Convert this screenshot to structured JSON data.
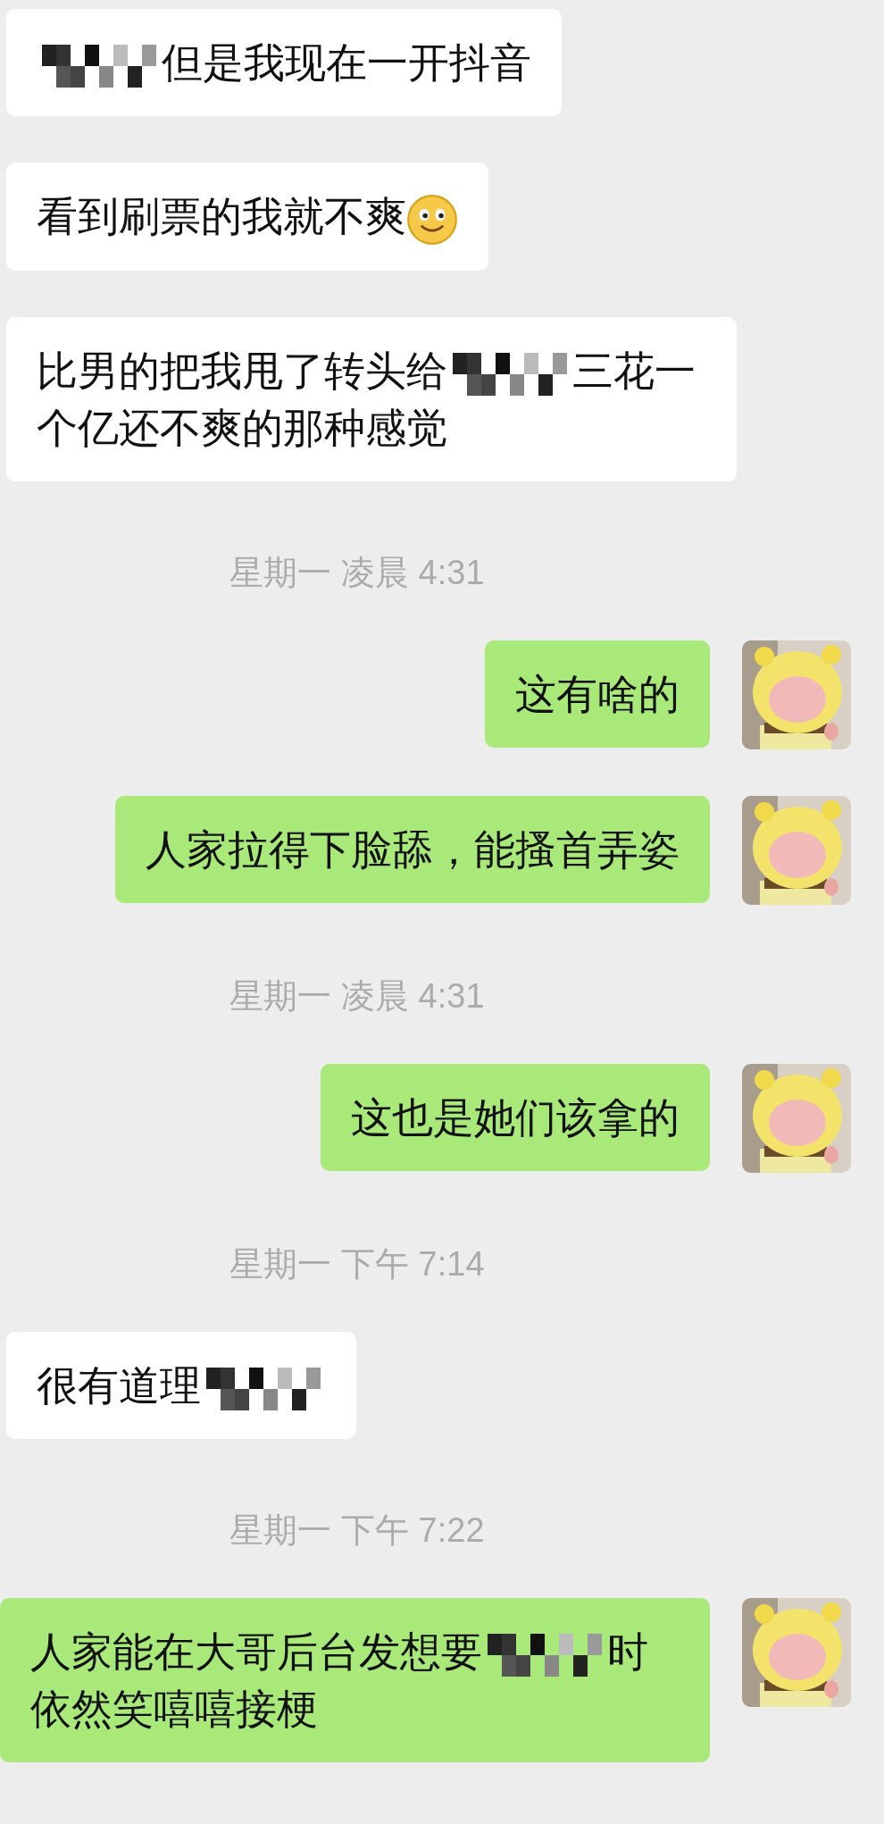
{
  "messages": [
    {
      "kind": "message",
      "outgoing": false,
      "parts": [
        {
          "kind": "mosaic"
        },
        {
          "kind": "text",
          "text": "但是我现在一开抖音"
        }
      ]
    },
    {
      "kind": "message",
      "outgoing": false,
      "parts": [
        {
          "kind": "text",
          "text": "看到刷票的我就不爽"
        },
        {
          "kind": "emoji"
        }
      ]
    },
    {
      "kind": "message",
      "outgoing": false,
      "parts": [
        {
          "kind": "text",
          "text": "比男的把我甩了转头给"
        },
        {
          "kind": "mosaic"
        },
        {
          "kind": "text",
          "text": "三花一个亿还不爽的那种感觉"
        }
      ]
    },
    {
      "kind": "time",
      "text": "星期一 凌晨 4:31"
    },
    {
      "kind": "message",
      "outgoing": true,
      "parts": [
        {
          "kind": "text",
          "text": "这有啥的"
        }
      ]
    },
    {
      "kind": "message",
      "outgoing": true,
      "parts": [
        {
          "kind": "text",
          "text": "人家拉得下脸舔，能搔首弄姿"
        }
      ]
    },
    {
      "kind": "time",
      "text": "星期一 凌晨 4:31"
    },
    {
      "kind": "message",
      "outgoing": true,
      "parts": [
        {
          "kind": "text",
          "text": "这也是她们该拿的"
        }
      ]
    },
    {
      "kind": "time",
      "text": "星期一 下午 7:14"
    },
    {
      "kind": "message",
      "outgoing": false,
      "parts": [
        {
          "kind": "text",
          "text": "很有道理"
        },
        {
          "kind": "mosaic"
        }
      ]
    },
    {
      "kind": "time",
      "text": "星期一 下午 7:22"
    },
    {
      "kind": "message",
      "outgoing": true,
      "parts": [
        {
          "kind": "text",
          "text": "人家能在大哥后台发想要"
        },
        {
          "kind": "mosaic"
        },
        {
          "kind": "text",
          "text": "时依然笑嘻嘻接梗"
        }
      ]
    }
  ]
}
